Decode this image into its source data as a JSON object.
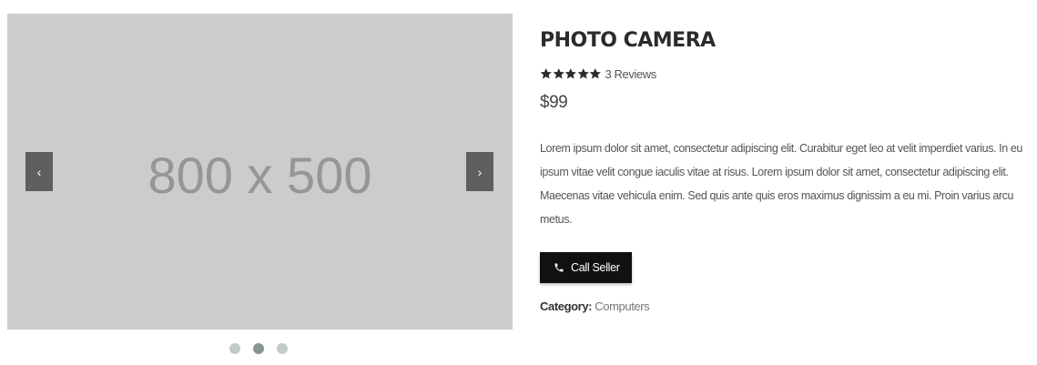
{
  "gallery": {
    "placeholder": "800 x 500",
    "prev_icon": "‹",
    "next_icon": "›",
    "dots": [
      {
        "active": false
      },
      {
        "active": true
      },
      {
        "active": false
      }
    ]
  },
  "product": {
    "title": "PHOTO CAMERA",
    "rating": 5,
    "reviews": "3 Reviews",
    "price": "$99",
    "description": "Lorem ipsum dolor sit amet, consectetur adipiscing elit. Curabitur eget leo at velit imperdiet varius. In eu ipsum vitae velit congue iaculis vitae at risus. Lorem ipsum dolor sit amet, consectetur adipiscing elit. Maecenas vitae vehicula enim. Sed quis ante quis eros maximus dignissim a eu mi. Proin varius arcu metus.",
    "call_button": "Call Seller",
    "category_label": "Category:",
    "category_value": "Computers"
  },
  "icons": {
    "star": "star-icon",
    "phone": "phone-icon"
  },
  "colors": {
    "button_bg": "#111111",
    "gallery_bg": "#cccccc",
    "dot_active": "#869691",
    "dot_inactive": "#c2cbc8"
  }
}
